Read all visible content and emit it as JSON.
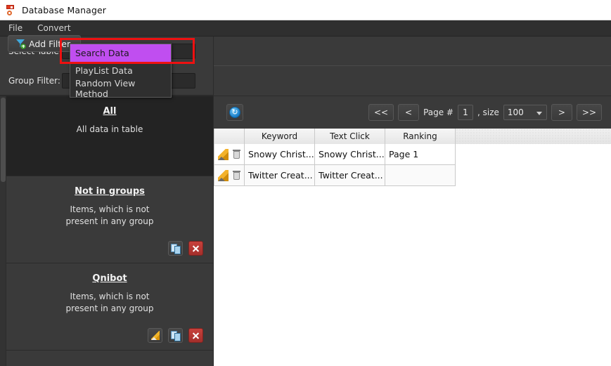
{
  "window": {
    "title": "Database Manager",
    "app_icon": "database-icon"
  },
  "menubar": {
    "items": [
      {
        "label": "File"
      },
      {
        "label": "Convert"
      }
    ]
  },
  "form": {
    "select_table_label": "Select Table:",
    "select_table_value": "Search Data",
    "group_filter_label": "Group Filter:",
    "group_filter_value": ""
  },
  "dropdown": {
    "open": true,
    "selected_index": 0,
    "highlight_color": "#c04ef0",
    "options": [
      {
        "label": "Search Data"
      },
      {
        "label": "PlayList Data"
      },
      {
        "label": "Random View Method"
      }
    ]
  },
  "toolbar": {
    "add_filter_label": "Add Filter",
    "add_filter_icon": "funnel-add-icon"
  },
  "pager": {
    "refresh_icon": "refresh-icon",
    "first_label": "<<",
    "prev_label": "<",
    "page_label": "Page #",
    "page_value": "1",
    "size_label": ", size",
    "size_value": "100",
    "next_label": ">",
    "last_label": ">>"
  },
  "groups": [
    {
      "title": "All",
      "description": "All data in table",
      "actions": []
    },
    {
      "title": "Not in groups",
      "description": "Items, which is not\npresent in any group",
      "description_line1": "Items, which is not",
      "description_line2": "present in any group",
      "actions": [
        "copy",
        "delete"
      ]
    },
    {
      "title": "Qnibot",
      "description": "Items, which is not\npresent in any group",
      "description_line1": "Items, which is not",
      "description_line2": "present in any group",
      "actions": [
        "edit",
        "copy",
        "delete"
      ]
    }
  ],
  "table": {
    "columns": [
      "",
      "Keyword",
      "Text Click",
      "Ranking"
    ],
    "rows": [
      {
        "actions": [
          "edit",
          "delete"
        ],
        "keyword": "Snowy Christ...",
        "text_click": "Snowy Christ...",
        "ranking": "Page 1"
      },
      {
        "actions": [
          "edit",
          "delete"
        ],
        "keyword": "Twitter Creat...",
        "text_click": "Twitter Creat...",
        "ranking": ""
      }
    ]
  },
  "colors": {
    "panel_bg": "#3a3a3a",
    "dark_bg": "#2b2b2b",
    "accent_purple": "#c04ef0",
    "highlight_red": "#ee1111",
    "table_bg": "#ffffff"
  }
}
